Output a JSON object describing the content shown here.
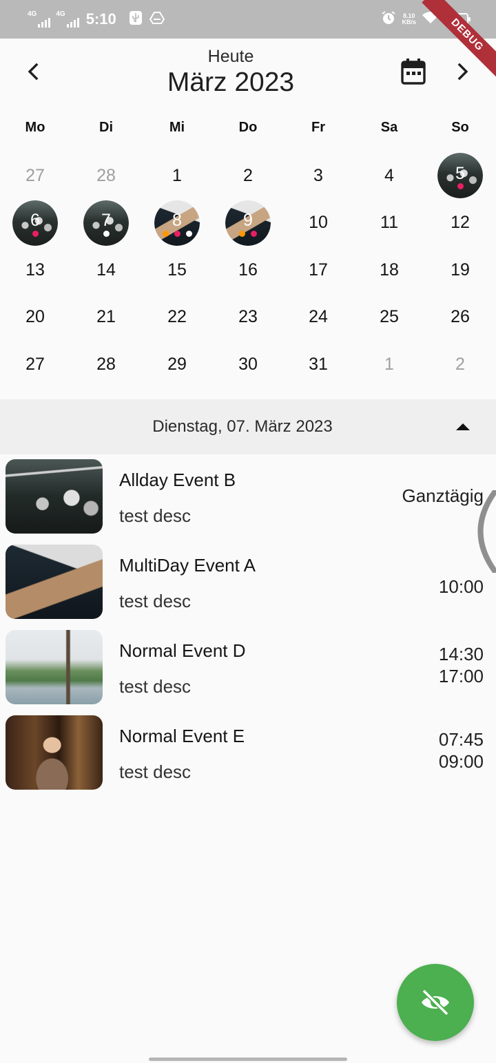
{
  "status_bar": {
    "network_1": "4G",
    "network_2": "4G",
    "time": "5:10",
    "speed_value": "8.10",
    "speed_unit": "KB/s"
  },
  "debug_banner": "DEBUG",
  "header": {
    "today_label": "Heute",
    "month_label": "März 2023",
    "prev_icon": "chevron-left-icon",
    "next_icon": "chevron-right-icon",
    "calendar_icon": "calendar-icon"
  },
  "weekdays": [
    "Mo",
    "Di",
    "Mi",
    "Do",
    "Fr",
    "Sa",
    "So"
  ],
  "weeks": [
    [
      {
        "d": "27",
        "out": true
      },
      {
        "d": "28",
        "out": true
      },
      {
        "d": "1"
      },
      {
        "d": "2"
      },
      {
        "d": "3"
      },
      {
        "d": "4"
      },
      {
        "d": "5",
        "img": "party",
        "dots": [
          "#e91e63"
        ]
      }
    ],
    [
      {
        "d": "6",
        "img": "party",
        "dots": [
          "#e91e63"
        ]
      },
      {
        "d": "7",
        "img": "party",
        "dots": [
          "#ffffff"
        ]
      },
      {
        "d": "8",
        "img": "desk",
        "dots": [
          "#ff9800",
          "#e91e63",
          "#ffffff"
        ]
      },
      {
        "d": "9",
        "img": "desk",
        "dots": [
          "#ff9800",
          "#e91e63"
        ]
      },
      {
        "d": "10"
      },
      {
        "d": "11"
      },
      {
        "d": "12"
      }
    ],
    [
      {
        "d": "13"
      },
      {
        "d": "14"
      },
      {
        "d": "15"
      },
      {
        "d": "16"
      },
      {
        "d": "17"
      },
      {
        "d": "18"
      },
      {
        "d": "19"
      }
    ],
    [
      {
        "d": "20"
      },
      {
        "d": "21"
      },
      {
        "d": "22"
      },
      {
        "d": "23"
      },
      {
        "d": "24"
      },
      {
        "d": "25"
      },
      {
        "d": "26"
      }
    ],
    [
      {
        "d": "27"
      },
      {
        "d": "28"
      },
      {
        "d": "29"
      },
      {
        "d": "30"
      },
      {
        "d": "31"
      },
      {
        "d": "1",
        "out": true
      },
      {
        "d": "2",
        "out": true
      }
    ]
  ],
  "selected_day": {
    "label": "Dienstag, 07. März 2023",
    "collapse_icon": "triangle-up-icon"
  },
  "events": [
    {
      "title": "Allday Event B",
      "desc": "test desc",
      "time_lines": [
        "Ganztägig"
      ],
      "thumb": "party"
    },
    {
      "title": "MultiDay Event A",
      "desc": "test desc",
      "time_lines": [
        "10:00"
      ],
      "thumb": "desk"
    },
    {
      "title": "Normal Event D",
      "desc": "test desc",
      "time_lines": [
        "14:30",
        "17:00"
      ],
      "thumb": "lake"
    },
    {
      "title": "Normal Event E",
      "desc": "test desc",
      "time_lines": [
        "07:45",
        "09:00"
      ],
      "thumb": "portrait"
    }
  ],
  "fab": {
    "icon": "visibility-off-icon",
    "color": "#4caf50"
  },
  "colors": {
    "status_bar": "#b9b9b9",
    "background": "#fafafa",
    "section_bar": "#efefef",
    "dot_orange": "#ff9800",
    "dot_pink": "#e91e63",
    "debug_ribbon": "#b0303a"
  }
}
